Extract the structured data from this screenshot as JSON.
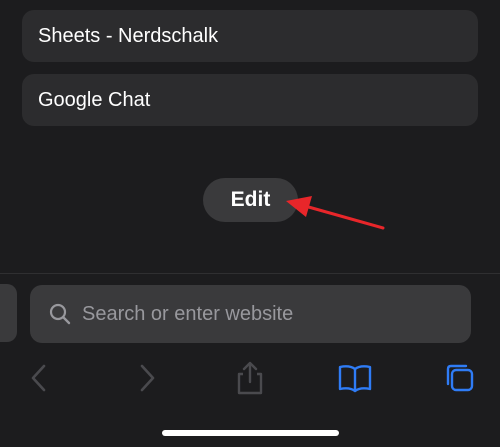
{
  "favorites": {
    "items": [
      {
        "label": "Sheets - Nerdschalk"
      },
      {
        "label": "Google Chat"
      }
    ],
    "edit_label": "Edit"
  },
  "address_bar": {
    "placeholder": "Search or enter website"
  },
  "toolbar": {
    "icons": [
      "back-icon",
      "forward-icon",
      "share-icon",
      "bookmarks-icon",
      "tabs-icon"
    ]
  },
  "colors": {
    "background": "#1c1c1e",
    "item_background": "#2c2c2e",
    "field_background": "#3a3a3c",
    "accent": "#2f7cf6",
    "annotation_arrow": "#e8262a"
  }
}
